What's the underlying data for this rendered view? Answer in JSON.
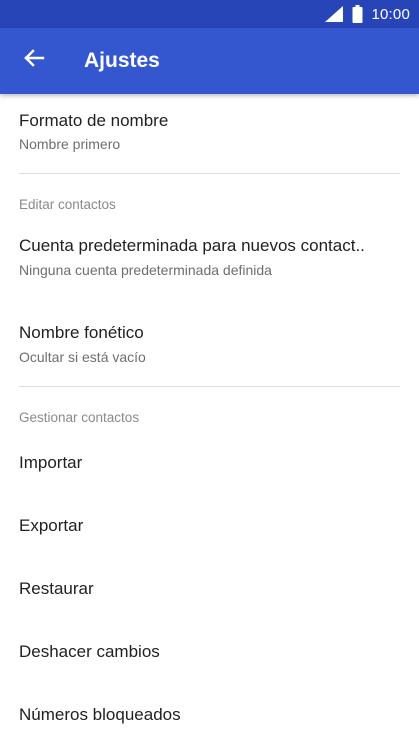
{
  "status_bar": {
    "time": "10:00",
    "signal_icon": "signal-icon",
    "battery_icon": "battery-icon",
    "background": "#2845b8"
  },
  "app_bar": {
    "title": "Ajustes",
    "back_icon": "arrow-back-icon",
    "background": "#3457d0"
  },
  "settings": {
    "name_format": {
      "title": "Formato de nombre",
      "value": "Nombre primero"
    },
    "edit_section": {
      "header": "Editar contactos",
      "default_account": {
        "title": "Cuenta predeterminada para nuevos contact..",
        "value": "Ninguna cuenta predeterminada definida"
      },
      "phonetic_name": {
        "title": "Nombre fonético",
        "value": "Ocultar si está vacío"
      }
    },
    "manage_section": {
      "header": "Gestionar contactos",
      "items": [
        "Importar",
        "Exportar",
        "Restaurar",
        "Deshacer cambios",
        "Números bloqueados"
      ]
    }
  }
}
